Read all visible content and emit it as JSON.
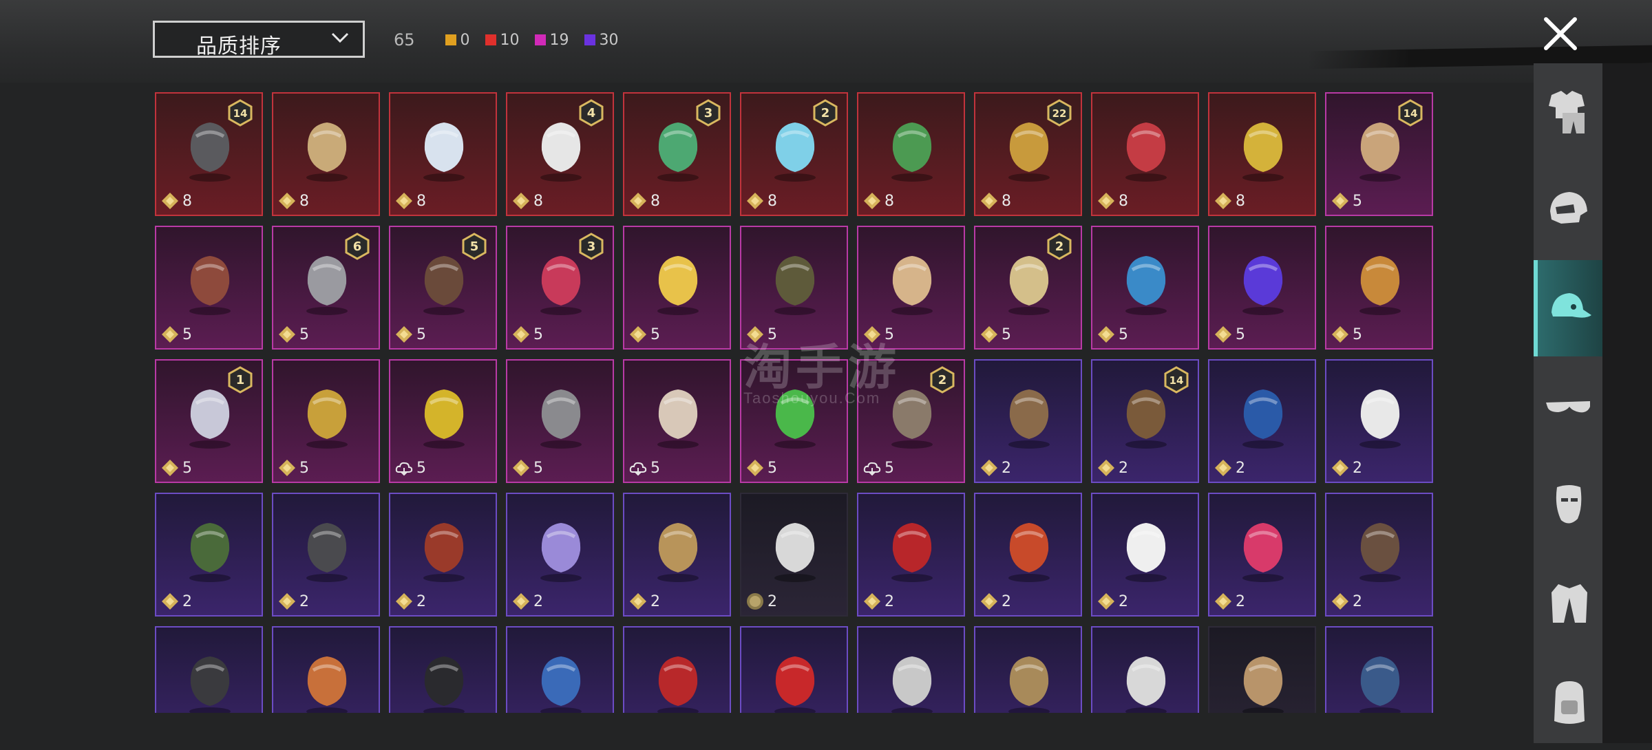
{
  "header": {
    "sort_label": "品质排序",
    "total_count": "65",
    "quality_counts": [
      {
        "color": "#e0a020",
        "count": "0"
      },
      {
        "color": "#e0302c",
        "count": "10"
      },
      {
        "color": "#d12ab8",
        "count": "19"
      },
      {
        "color": "#6a32e0",
        "count": "30"
      }
    ]
  },
  "sidebar": {
    "tabs": [
      {
        "name": "outfit",
        "icon": "outfit-icon"
      },
      {
        "name": "helmet",
        "icon": "helmet-icon"
      },
      {
        "name": "hat",
        "icon": "cap-icon",
        "active": true
      },
      {
        "name": "glasses",
        "icon": "glasses-icon"
      },
      {
        "name": "mask",
        "icon": "mask-icon"
      },
      {
        "name": "jacket",
        "icon": "jacket-icon"
      },
      {
        "name": "backpack",
        "icon": "backpack-icon"
      }
    ]
  },
  "watermark": {
    "text": "淘手游",
    "sub": "Taoshouyou.Com"
  },
  "items": [
    {
      "q": "red",
      "art": "#5a5a5e",
      "badge": "14",
      "price": "8",
      "cur": "diamond"
    },
    {
      "q": "red",
      "art": "#c9aa78",
      "badge": "",
      "price": "8",
      "cur": "diamond"
    },
    {
      "q": "red",
      "art": "#d8e2ee",
      "badge": "",
      "price": "8",
      "cur": "diamond"
    },
    {
      "q": "red",
      "art": "#e6e6e6",
      "badge": "4",
      "price": "8",
      "cur": "diamond"
    },
    {
      "q": "red",
      "art": "#4da872",
      "badge": "3",
      "price": "8",
      "cur": "diamond"
    },
    {
      "q": "red",
      "art": "#7fd0e8",
      "badge": "2",
      "price": "8",
      "cur": "diamond"
    },
    {
      "q": "red",
      "art": "#4c9a52",
      "badge": "",
      "price": "8",
      "cur": "diamond"
    },
    {
      "q": "red",
      "art": "#c89a3c",
      "badge": "22",
      "price": "8",
      "cur": "diamond"
    },
    {
      "q": "red",
      "art": "#c43c44",
      "badge": "",
      "price": "8",
      "cur": "diamond"
    },
    {
      "q": "red",
      "art": "#d4b23a",
      "badge": "",
      "price": "8",
      "cur": "diamond"
    },
    {
      "q": "pink",
      "art": "#c9a47a",
      "badge": "14",
      "price": "5",
      "cur": "diamond"
    },
    {
      "q": "pink",
      "art": "#8e4a3c",
      "badge": "",
      "price": "5",
      "cur": "diamond"
    },
    {
      "q": "pink",
      "art": "#9a9aa0",
      "badge": "6",
      "price": "5",
      "cur": "diamond"
    },
    {
      "q": "pink",
      "art": "#6a4a3a",
      "badge": "5",
      "price": "5",
      "cur": "diamond"
    },
    {
      "q": "pink",
      "art": "#c83a5a",
      "badge": "3",
      "price": "5",
      "cur": "diamond"
    },
    {
      "q": "pink",
      "art": "#e8c24a",
      "badge": "",
      "price": "5",
      "cur": "diamond"
    },
    {
      "q": "pink",
      "art": "#5e5a3a",
      "badge": "",
      "price": "5",
      "cur": "diamond"
    },
    {
      "q": "pink",
      "art": "#d6b48a",
      "badge": "",
      "price": "5",
      "cur": "diamond"
    },
    {
      "q": "pink",
      "art": "#d4bf8a",
      "badge": "2",
      "price": "5",
      "cur": "diamond"
    },
    {
      "q": "pink",
      "art": "#3a8ac8",
      "badge": "",
      "price": "5",
      "cur": "diamond"
    },
    {
      "q": "pink",
      "art": "#5a3ad8",
      "badge": "",
      "price": "5",
      "cur": "diamond"
    },
    {
      "q": "pink",
      "art": "#c8893a",
      "badge": "",
      "price": "5",
      "cur": "diamond"
    },
    {
      "q": "pink",
      "art": "#c8c8d8",
      "badge": "1",
      "price": "5",
      "cur": "diamond"
    },
    {
      "q": "pink",
      "art": "#c8a03a",
      "badge": "",
      "price": "5",
      "cur": "diamond"
    },
    {
      "q": "pink",
      "art": "#d4b42a",
      "badge": "",
      "price": "5",
      "cur": "cloud"
    },
    {
      "q": "pink",
      "art": "#8a8a8e",
      "badge": "",
      "price": "5",
      "cur": "diamond"
    },
    {
      "q": "pink",
      "art": "#d8c8b8",
      "badge": "",
      "price": "5",
      "cur": "cloud"
    },
    {
      "q": "pink",
      "art": "#4ab84a",
      "badge": "",
      "price": "5",
      "cur": "diamond"
    },
    {
      "q": "pink",
      "art": "#8a7a6a",
      "badge": "2",
      "price": "5",
      "cur": "cloud"
    },
    {
      "q": "purple",
      "art": "#8a6a4a",
      "badge": "",
      "price": "2",
      "cur": "diamond"
    },
    {
      "q": "purple",
      "art": "#7a5a3a",
      "badge": "14",
      "price": "2",
      "cur": "diamond"
    },
    {
      "q": "purple",
      "art": "#2a5aa8",
      "badge": "",
      "price": "2",
      "cur": "diamond"
    },
    {
      "q": "purple",
      "art": "#e8e8e8",
      "badge": "",
      "price": "2",
      "cur": "diamond"
    },
    {
      "q": "purple",
      "art": "#4a6a3a",
      "badge": "",
      "price": "2",
      "cur": "diamond"
    },
    {
      "q": "purple",
      "art": "#4a4a4e",
      "badge": "",
      "price": "2",
      "cur": "diamond"
    },
    {
      "q": "purple",
      "art": "#9a3a2a",
      "badge": "",
      "price": "2",
      "cur": "diamond"
    },
    {
      "q": "purple",
      "art": "#9a8ad8",
      "badge": "",
      "price": "2",
      "cur": "diamond"
    },
    {
      "q": "purple",
      "art": "#b8945a",
      "badge": "",
      "price": "2",
      "cur": "diamond"
    },
    {
      "q": "black",
      "art": "#d8d8d8",
      "badge": "",
      "price": "2",
      "cur": "coin"
    },
    {
      "q": "purple",
      "art": "#b8262a",
      "badge": "",
      "price": "2",
      "cur": "diamond"
    },
    {
      "q": "purple",
      "art": "#c84a2a",
      "badge": "",
      "price": "2",
      "cur": "diamond"
    },
    {
      "q": "purple",
      "art": "#efefef",
      "badge": "",
      "price": "2",
      "cur": "diamond"
    },
    {
      "q": "purple",
      "art": "#d83a6a",
      "badge": "",
      "price": "2",
      "cur": "diamond"
    },
    {
      "q": "purple",
      "art": "#6a5040",
      "badge": "",
      "price": "2",
      "cur": "diamond"
    },
    {
      "q": "purple",
      "art": "#3a3a3e",
      "badge": "",
      "price": "",
      "cur": ""
    },
    {
      "q": "purple",
      "art": "#c8703a",
      "badge": "",
      "price": "",
      "cur": ""
    },
    {
      "q": "purple",
      "art": "#2a2a2e",
      "badge": "",
      "price": "",
      "cur": ""
    },
    {
      "q": "purple",
      "art": "#3a6ab8",
      "badge": "",
      "price": "",
      "cur": ""
    },
    {
      "q": "purple",
      "art": "#b8282a",
      "badge": "",
      "price": "",
      "cur": ""
    },
    {
      "q": "purple",
      "art": "#c8282a",
      "badge": "",
      "price": "",
      "cur": ""
    },
    {
      "q": "purple",
      "art": "#c8c8c8",
      "badge": "",
      "price": "",
      "cur": ""
    },
    {
      "q": "purple",
      "art": "#a88a5a",
      "badge": "",
      "price": "",
      "cur": ""
    },
    {
      "q": "purple",
      "art": "#d8d8d8",
      "badge": "",
      "price": "",
      "cur": ""
    },
    {
      "q": "black",
      "art": "#b8946a",
      "badge": "",
      "price": "",
      "cur": ""
    },
    {
      "q": "purple",
      "art": "#3a5a8a",
      "badge": "",
      "price": "",
      "cur": ""
    }
  ]
}
